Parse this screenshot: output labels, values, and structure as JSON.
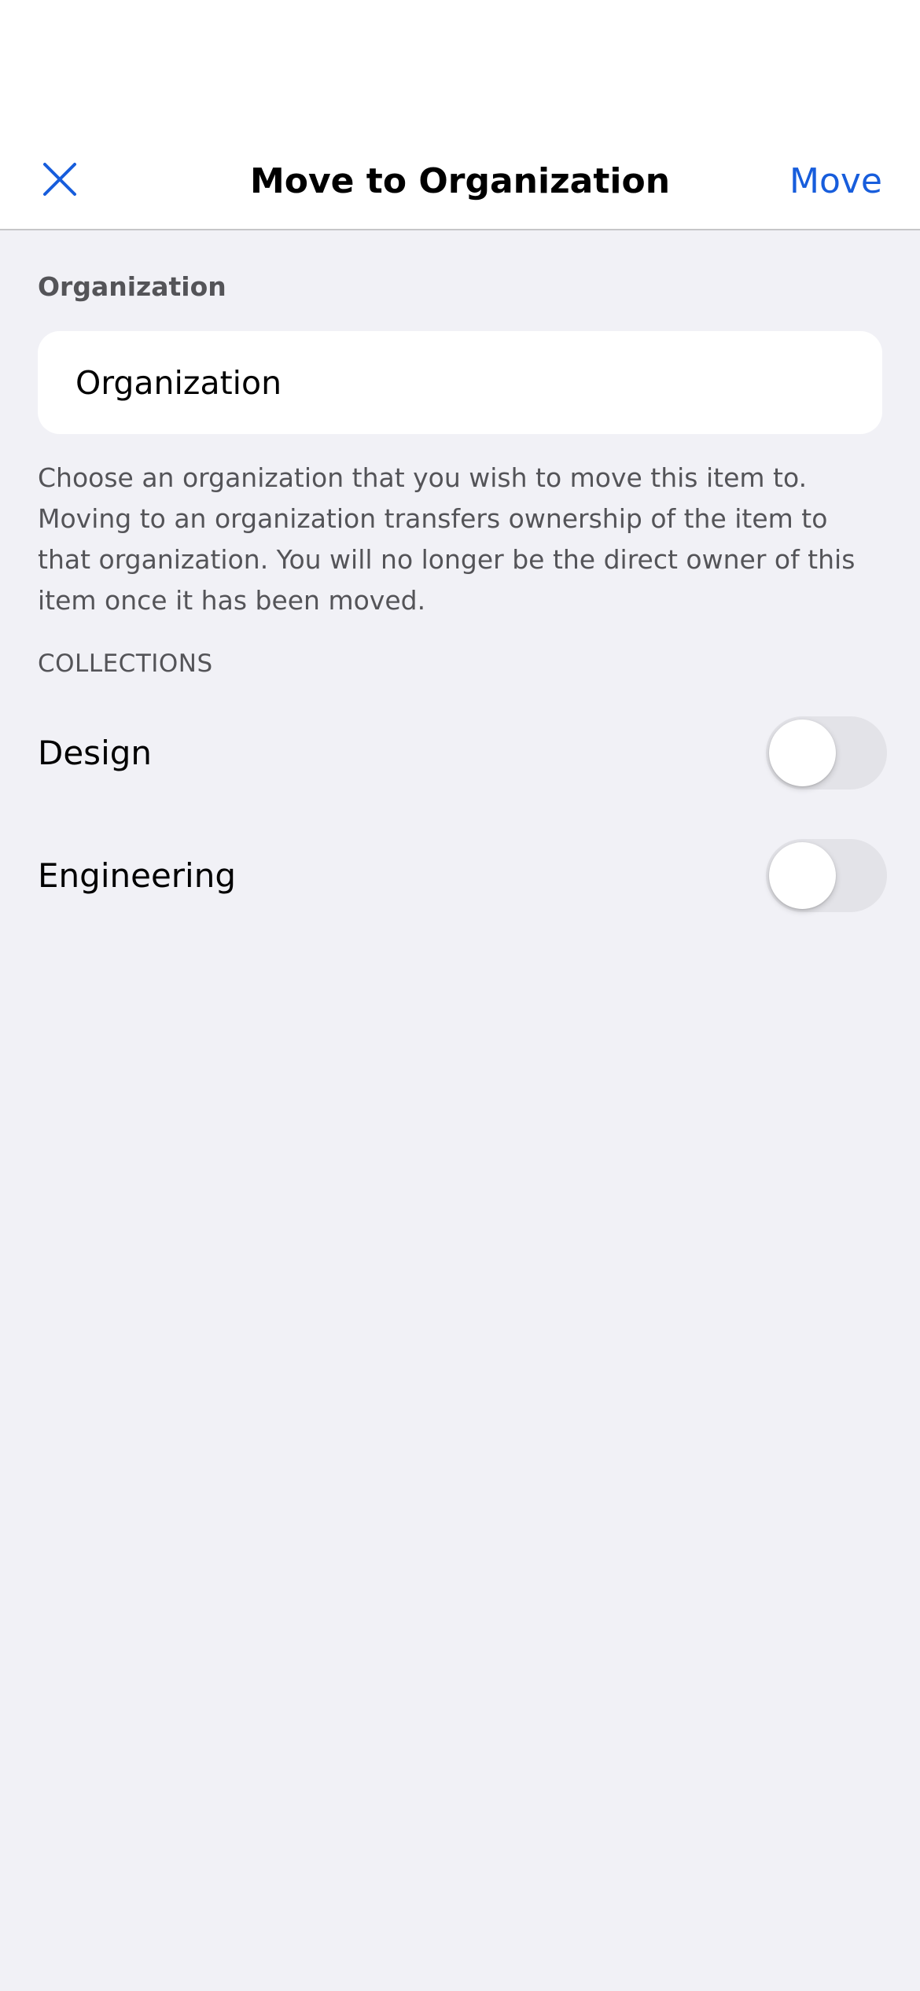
{
  "nav": {
    "title": "Move to Organization",
    "move_label": "Move",
    "close_icon": "close-icon",
    "accent_color": "#175ddc"
  },
  "organization": {
    "label": "Organization",
    "value": "Organization",
    "help_text": "Choose an organization that you wish to move this item to. Moving to an organization transfers ownership of the item to that organization. You will no longer be the direct owner of this item once it has been moved."
  },
  "collections": {
    "header": "COLLECTIONS",
    "items": [
      {
        "label": "Design",
        "enabled": false
      },
      {
        "label": "Engineering",
        "enabled": false
      }
    ]
  }
}
